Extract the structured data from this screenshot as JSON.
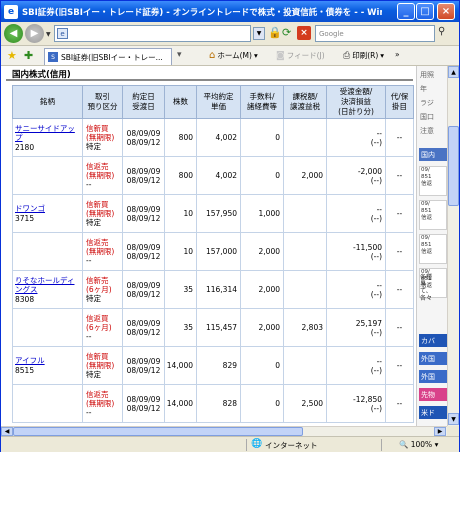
{
  "window": {
    "title": "SBI証券(旧SBIイー・トレード証券) - オンライントレードで株式・投資信託・債券を - - Windo..."
  },
  "address_bar": {
    "url": "",
    "search_placeholder": "Google"
  },
  "tab": {
    "label": "SBI証券(旧SBIイー・トレー..."
  },
  "commands": {
    "home": "ホーム(M)",
    "feed": "フィード(J)",
    "print": "印刷(R)",
    "more": "»"
  },
  "section": {
    "title": "国内株式(信用)"
  },
  "table": {
    "headers": [
      "銘柄",
      "取引\n預り区分",
      "約定日\n受渡日",
      "株数",
      "平均約定\n単価",
      "手数料/\n諸経費等",
      "課税額/\n譲渡益税",
      "受渡金額/\n決済損益\n(日計り分)",
      "代/保\n掛目"
    ],
    "rows": [
      {
        "name": "サニーサイドアップ",
        "code": "2180",
        "kind1": "信新買",
        "kind2": "(無期限)",
        "kind3": "特定",
        "date1": "08/09/09",
        "date2": "08/09/12",
        "qty": "800",
        "price": "4,002",
        "fee": "0",
        "tax": "",
        "amt1": "--",
        "amt2": "(--)",
        "margin": "--"
      },
      {
        "name": "",
        "code": "",
        "kind1": "信返売",
        "kind2": "(無期限)",
        "kind3": "--",
        "date1": "08/09/09",
        "date2": "08/09/12",
        "qty": "800",
        "price": "4,002",
        "fee": "0",
        "tax": "2,000",
        "amt1": "-2,000",
        "amt2": "(--)",
        "margin": "--"
      },
      {
        "name": "ドワンゴ",
        "code": "3715",
        "kind1": "信新買",
        "kind2": "(無期限)",
        "kind3": "特定",
        "date1": "08/09/09",
        "date2": "08/09/12",
        "qty": "10",
        "price": "157,950",
        "fee": "1,000",
        "tax": "",
        "amt1": "--",
        "amt2": "(--)",
        "margin": "--"
      },
      {
        "name": "",
        "code": "",
        "kind1": "信返売",
        "kind2": "(無期限)",
        "kind3": "--",
        "date1": "08/09/09",
        "date2": "08/09/12",
        "qty": "10",
        "price": "157,000",
        "fee": "2,000",
        "tax": "",
        "amt1": "-11,500",
        "amt2": "(--)",
        "margin": "--"
      },
      {
        "name": "りそなホールディングス",
        "code": "8308",
        "kind1": "信新売",
        "kind2": "(6ヶ月)",
        "kind3": "特定",
        "date1": "08/09/09",
        "date2": "08/09/12",
        "qty": "35",
        "price": "116,314",
        "fee": "2,000",
        "tax": "",
        "amt1": "--",
        "amt2": "(--)",
        "margin": "--"
      },
      {
        "name": "",
        "code": "",
        "kind1": "信返買",
        "kind2": "(6ヶ月)",
        "kind3": "--",
        "date1": "08/09/09",
        "date2": "08/09/12",
        "qty": "35",
        "price": "115,457",
        "fee": "2,000",
        "tax": "2,803",
        "amt1": "25,197",
        "amt2": "(--)",
        "margin": "--"
      },
      {
        "name": "アイフル",
        "code": "8515",
        "kind1": "信新買",
        "kind2": "(無期限)",
        "kind3": "特定",
        "date1": "08/09/09",
        "date2": "08/09/12",
        "qty": "14,000",
        "price": "829",
        "fee": "0",
        "tax": "",
        "amt1": "--",
        "amt2": "(--)",
        "margin": "--"
      },
      {
        "name": "",
        "code": "",
        "kind1": "信返売",
        "kind2": "(無期限)",
        "kind3": "--",
        "date1": "08/09/09",
        "date2": "08/09/12",
        "qty": "14,000",
        "price": "828",
        "fee": "0",
        "tax": "2,500",
        "amt1": "-12,850",
        "amt2": "(--)",
        "margin": "--"
      }
    ]
  },
  "side_panel": {
    "text1": "用照",
    "text2": "年",
    "text3": "ラジ",
    "text4": "国口",
    "text5": "注意",
    "chip1": "国内",
    "card1": "09/\n851\n信返",
    "card2": "09/\n851\n信返",
    "card3": "09/\n851\n信返",
    "card4": "09/\n851\n信返",
    "note": "各種\n黒・\nて、\n各々",
    "chip2": "カバ",
    "chip3": "外国",
    "chip4": "外国",
    "chip5": "先物",
    "chip6": "米ド"
  },
  "statusbar": {
    "zone": "インターネット",
    "zoom": "100%"
  },
  "colors": {
    "titlebar": "#0a5ddf",
    "header_bg": "#d6e3f3",
    "link": "#0000cc",
    "accent_red": "#cc0000"
  }
}
